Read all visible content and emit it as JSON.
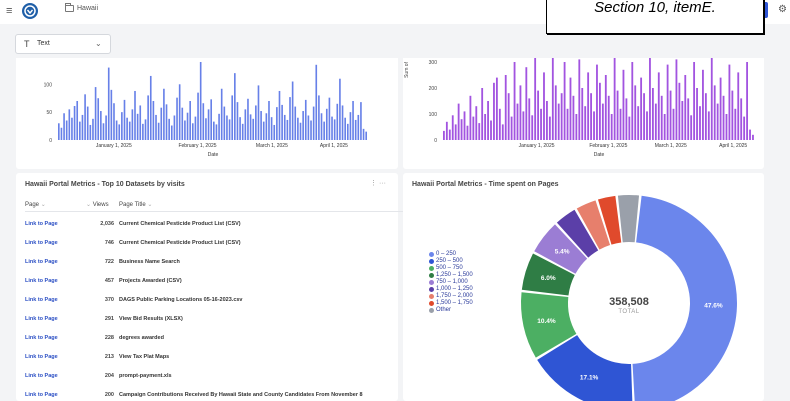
{
  "topbar": {
    "menu_icon": "hamburger-icon",
    "breadcrumb": "Hawaii",
    "tooltip": "Section 10, itemE."
  },
  "filter": {
    "label": "Text",
    "icon": "text-type-icon"
  },
  "colors": {
    "bar_blue": "#6780e8",
    "bar_purple": "#a254e0",
    "link_blue": "#2b4fc4"
  },
  "chart_left": {
    "xlabel": "Date",
    "y_ticks": [
      "0",
      "50",
      "100"
    ],
    "x_ticks": [
      "January 1, 2025",
      "February 1, 2025",
      "March 1, 2025",
      "April 1, 2025"
    ],
    "values": [
      30,
      22,
      48,
      35,
      55,
      40,
      61,
      70,
      33,
      45,
      82,
      60,
      27,
      38,
      95,
      75,
      52,
      30,
      44,
      130,
      90,
      66,
      35,
      28,
      50,
      72,
      40,
      33,
      55,
      88,
      47,
      62,
      29,
      37,
      80,
      115,
      70,
      45,
      31,
      58,
      92,
      64,
      38,
      26,
      44,
      76,
      100,
      58,
      35,
      49,
      70,
      30,
      42,
      85,
      140,
      66,
      39,
      55,
      73,
      33,
      28,
      47,
      92,
      60,
      44,
      37,
      80,
      120,
      68,
      41,
      29,
      55,
      74,
      46,
      38,
      62,
      98,
      52,
      33,
      48,
      70,
      41,
      27,
      59,
      88,
      63,
      45,
      36,
      77,
      105,
      60,
      40,
      31,
      52,
      72,
      44,
      35,
      60,
      135,
      80,
      48,
      33,
      56,
      76,
      42,
      37,
      65,
      110,
      62,
      40,
      29,
      50,
      70,
      36,
      45,
      68,
      20,
      15
    ]
  },
  "chart_right": {
    "xlabel": "Date",
    "ylabel": "Sum of",
    "y_ticks": [
      "0",
      "100",
      "200",
      "300"
    ],
    "x_ticks": [
      "January 1, 2025",
      "February 1, 2025",
      "March 1, 2025",
      "April 1, 2025"
    ],
    "values": [
      35,
      70,
      40,
      95,
      60,
      140,
      80,
      110,
      55,
      170,
      90,
      130,
      65,
      200,
      100,
      150,
      75,
      220,
      240,
      120,
      60,
      250,
      180,
      90,
      300,
      140,
      210,
      110,
      280,
      160,
      95,
      320,
      190,
      120,
      260,
      150,
      90,
      330,
      210,
      140,
      180,
      300,
      120,
      240,
      170,
      100,
      310,
      200,
      130,
      260,
      180,
      110,
      290,
      220,
      140,
      250,
      170,
      100,
      330,
      190,
      120,
      270,
      160,
      90,
      300,
      210,
      130,
      240,
      180,
      110,
      320,
      200,
      140,
      260,
      170,
      100,
      290,
      190,
      120,
      310,
      220,
      150,
      250,
      160,
      95,
      300,
      200,
      130,
      270,
      180,
      110,
      330,
      210,
      140,
      240,
      170,
      100,
      290,
      190,
      120,
      260,
      160,
      90,
      300,
      40,
      20
    ]
  },
  "table_card": {
    "title": "Hawaii Portal Metrics - Top 10 Datasets by visits",
    "menu": "⋮ ···",
    "headers": {
      "page": "Page",
      "views": "Views",
      "title": "Page Title"
    },
    "rows": [
      {
        "link": "Link to Page",
        "views": "2,036",
        "title": "Current Chemical Pesticide Product List (CSV)"
      },
      {
        "link": "Link to Page",
        "views": "746",
        "title": "Current Chemical Pesticide Product List (CSV)"
      },
      {
        "link": "Link to Page",
        "views": "722",
        "title": "Business Name Search"
      },
      {
        "link": "Link to Page",
        "views": "457",
        "title": "Projects Awarded (CSV)"
      },
      {
        "link": "Link to Page",
        "views": "370",
        "title": "DAGS Public Parking Locations 05-16-2023.csv"
      },
      {
        "link": "Link to Page",
        "views": "291",
        "title": "View Bid Results (XLSX)"
      },
      {
        "link": "Link to Page",
        "views": "228",
        "title": "degrees awarded"
      },
      {
        "link": "Link to Page",
        "views": "213",
        "title": "View Tax Plat Maps"
      },
      {
        "link": "Link to Page",
        "views": "204",
        "title": "prompt-payment.xls"
      },
      {
        "link": "Link to Page",
        "views": "200",
        "title": "Campaign Contributions Received By Hawaii State and County Candidates From November 8"
      }
    ]
  },
  "donut_card": {
    "title": "Hawaii Portal Metrics - Time spent on Pages",
    "total_value": "358,508",
    "total_label": "TOTAL",
    "legend": [
      {
        "label": "0 – 250",
        "color": "#6b86ec"
      },
      {
        "label": "250 – 500",
        "color": "#2f55d4"
      },
      {
        "label": "500 – 750",
        "color": "#4caf63"
      },
      {
        "label": "1,250 – 1,500",
        "color": "#2f7d45"
      },
      {
        "label": "750 – 1,000",
        "color": "#9b7dd4"
      },
      {
        "label": "1,000 – 1,250",
        "color": "#5b3fa8"
      },
      {
        "label": "1,750 – 2,000",
        "color": "#e77f6c"
      },
      {
        "label": "1,500 – 1,750",
        "color": "#e04a2c"
      },
      {
        "label": "Other",
        "color": "#9aa0aa"
      }
    ],
    "slices": [
      {
        "label": "47.6%",
        "value": 47.6,
        "color": "#6b86ec"
      },
      {
        "label": "17.1%",
        "value": 17.1,
        "color": "#2f55d4"
      },
      {
        "label": "10.4%",
        "value": 10.4,
        "color": "#4caf63"
      },
      {
        "label": "6.0%",
        "value": 6.0,
        "color": "#2f7d45"
      },
      {
        "label": "5.4%",
        "value": 5.4,
        "color": "#9b7dd4"
      },
      {
        "label": "",
        "value": 3.6,
        "color": "#5b3fa8"
      },
      {
        "label": "",
        "value": 3.4,
        "color": "#e77f6c"
      },
      {
        "label": "",
        "value": 3.0,
        "color": "#e04a2c"
      },
      {
        "label": "",
        "value": 3.5,
        "color": "#9aa0aa"
      }
    ]
  }
}
